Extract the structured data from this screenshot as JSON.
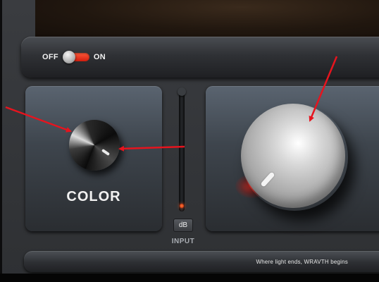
{
  "power": {
    "off_label": "OFF",
    "on_label": "ON",
    "state": "on"
  },
  "color_panel": {
    "label": "COLOR"
  },
  "input_section": {
    "db_button_label": "dB",
    "label": "INPUT"
  },
  "footer": {
    "tagline": "Where light ends, WRAVTH begins"
  },
  "colors": {
    "accent": "#e0281a",
    "annotation_arrow": "#e6141e",
    "panel_text": "#f1f1f1"
  }
}
